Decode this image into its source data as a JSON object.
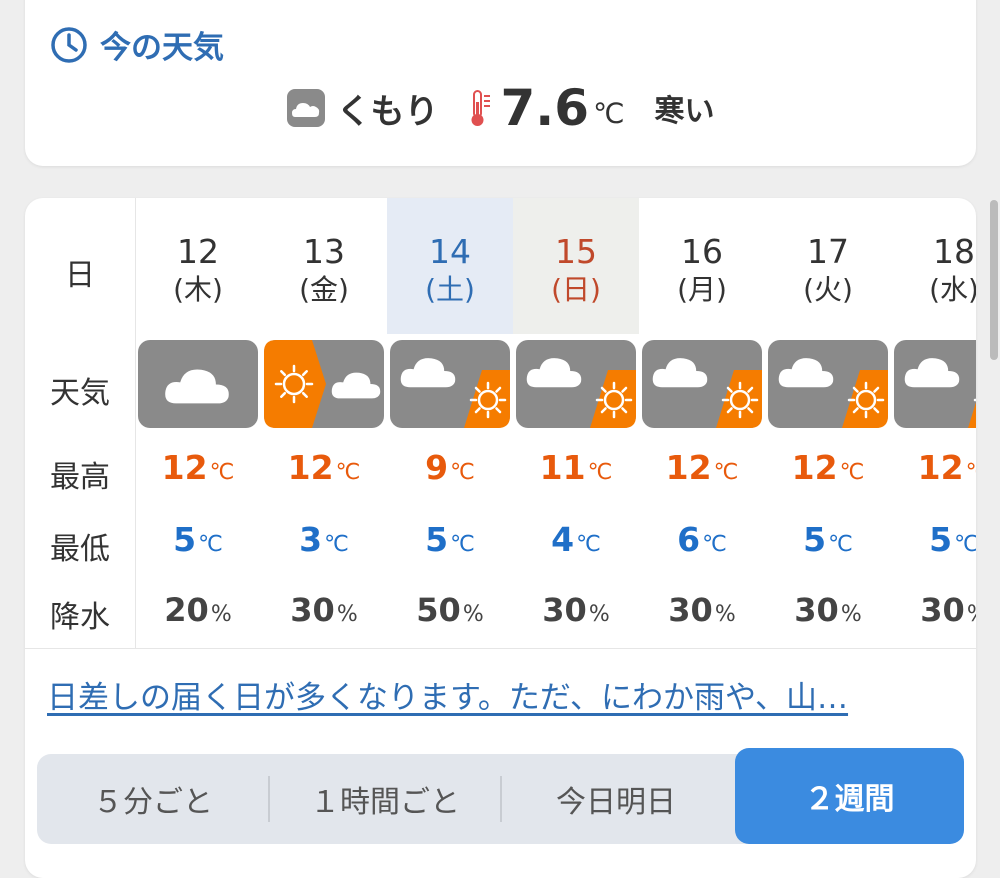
{
  "now": {
    "title": "今の天気",
    "condition": "くもり",
    "temperature": "7.6",
    "temp_unit": "℃",
    "feel": "寒い",
    "icons": [
      "clock-icon",
      "cloud-icon",
      "thermometer-icon"
    ]
  },
  "forecast": {
    "row_labels": {
      "date": "日",
      "weather": "天気",
      "high": "最高",
      "low": "最低",
      "precip": "降水"
    },
    "temp_unit": "℃",
    "precip_unit": "%",
    "days": [
      {
        "date": "12",
        "weekday": "(木)",
        "type": "weekday",
        "weather": "cloudy",
        "high": "12",
        "low": "5",
        "precip": "20"
      },
      {
        "date": "13",
        "weekday": "(金)",
        "type": "weekday",
        "weather": "sunny-then-cloudy",
        "high": "12",
        "low": "3",
        "precip": "30"
      },
      {
        "date": "14",
        "weekday": "(土)",
        "type": "saturday",
        "weather": "cloudy-sometimes-sunny",
        "high": "9",
        "low": "5",
        "precip": "50"
      },
      {
        "date": "15",
        "weekday": "(日)",
        "type": "sunday",
        "weather": "cloudy-sometimes-sunny",
        "high": "11",
        "low": "4",
        "precip": "30"
      },
      {
        "date": "16",
        "weekday": "(月)",
        "type": "weekday",
        "weather": "cloudy-sometimes-sunny",
        "high": "12",
        "low": "6",
        "precip": "30"
      },
      {
        "date": "17",
        "weekday": "(火)",
        "type": "weekday",
        "weather": "cloudy-sometimes-sunny",
        "high": "12",
        "low": "5",
        "precip": "30"
      },
      {
        "date": "18",
        "weekday": "(水)",
        "type": "weekday",
        "weather": "cloudy-sometimes-sunny",
        "high": "12",
        "low": "5",
        "precip": "30"
      }
    ],
    "summary": "日差しの届く日が多くなります。ただ、にわか雨や、山…"
  },
  "tabs": [
    {
      "label": "５分ごと",
      "active": false
    },
    {
      "label": "１時間ごと",
      "active": false
    },
    {
      "label": "今日明日",
      "active": false
    },
    {
      "label": "２週間",
      "active": true
    }
  ],
  "colors": {
    "accent": "#2f6db3",
    "high": "#e85a0c",
    "low": "#1f6fc8",
    "tab_active": "#3b8be0",
    "sun": "#f57c00",
    "cloud_bg": "#8a8a8a"
  }
}
